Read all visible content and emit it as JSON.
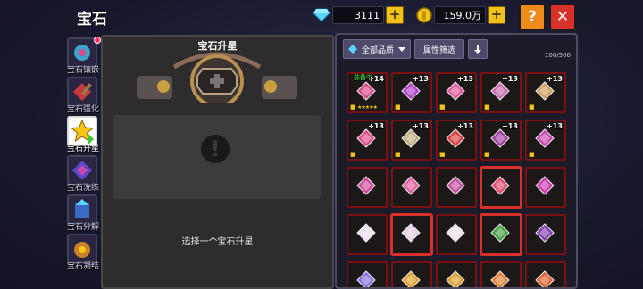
{
  "header": {
    "title": "宝石"
  },
  "currency": {
    "diamonds": {
      "value": "3111",
      "icon": "diamond-icon"
    },
    "gold": {
      "value": "159.0万",
      "icon": "gold-coin-icon"
    }
  },
  "buttons": {
    "help": "?",
    "close": "✕",
    "plus": "+"
  },
  "sidebar": {
    "items": [
      {
        "label": "宝石镶嵌",
        "icon": "gem-inlay-icon",
        "active": false,
        "badge": true
      },
      {
        "label": "宝石强化",
        "icon": "gem-enhance-icon",
        "active": false
      },
      {
        "label": "宝石升星",
        "icon": "gem-star-icon",
        "active": true
      },
      {
        "label": "宝石洗练",
        "icon": "gem-refine-icon",
        "active": false
      },
      {
        "label": "宝石分解",
        "icon": "gem-decompose-icon",
        "active": false
      },
      {
        "label": "宝石凝结",
        "icon": "gem-condense-icon",
        "active": false
      }
    ]
  },
  "left_panel": {
    "title": "宝石升星",
    "prompt": "选择一个宝石升星"
  },
  "right_panel": {
    "filter_quality": "全部品质",
    "filter_attr": "属性筛选",
    "sort_icon": "sort-down-icon",
    "count": "100/500",
    "equipped_tag": "装备中",
    "slots": [
      {
        "level": "+14",
        "equipped": true,
        "stars": "★★★★★",
        "gem": "#d84a8a",
        "highlight": false
      },
      {
        "level": "+13",
        "gem": "#b040c8",
        "highlight": false
      },
      {
        "level": "+13",
        "gem": "#e05a9a",
        "highlight": false
      },
      {
        "level": "+13",
        "gem": "#c86ab0",
        "highlight": false
      },
      {
        "level": "+13",
        "gem": "#d0a060",
        "highlight": false
      },
      {
        "level": "+13",
        "gem": "#e04a8a",
        "highlight": false
      },
      {
        "level": "+13",
        "gem": "#c0b080",
        "highlight": false
      },
      {
        "level": "+13",
        "gem": "#d84040",
        "highlight": false
      },
      {
        "level": "+13",
        "gem": "#a040a0",
        "highlight": false
      },
      {
        "level": "+13",
        "gem": "#c84ab0",
        "highlight": false
      },
      {
        "level": "",
        "gem": "#d04a9a",
        "highlight": false
      },
      {
        "level": "",
        "gem": "#e060a0",
        "highlight": false
      },
      {
        "level": "",
        "gem": "#c050a0",
        "highlight": false
      },
      {
        "level": "",
        "gem": "#e04a6a",
        "highlight": true
      },
      {
        "level": "",
        "gem": "#d03ab0",
        "highlight": false
      },
      {
        "level": "",
        "gem": "#f0e0f0",
        "highlight": false
      },
      {
        "level": "",
        "gem": "#e8d0e0",
        "highlight": true
      },
      {
        "level": "",
        "gem": "#f0e0f0",
        "highlight": false
      },
      {
        "level": "",
        "gem": "#40a040",
        "highlight": true
      },
      {
        "level": "",
        "gem": "#8040b0",
        "highlight": false
      },
      {
        "level": "",
        "gem": "#8a70e0",
        "highlight": false
      },
      {
        "level": "",
        "gem": "#e0a030",
        "highlight": false
      },
      {
        "level": "",
        "gem": "#e0a030",
        "highlight": false
      },
      {
        "level": "",
        "gem": "#e08030",
        "highlight": false
      },
      {
        "level": "",
        "gem": "#e06030",
        "highlight": false
      }
    ]
  }
}
